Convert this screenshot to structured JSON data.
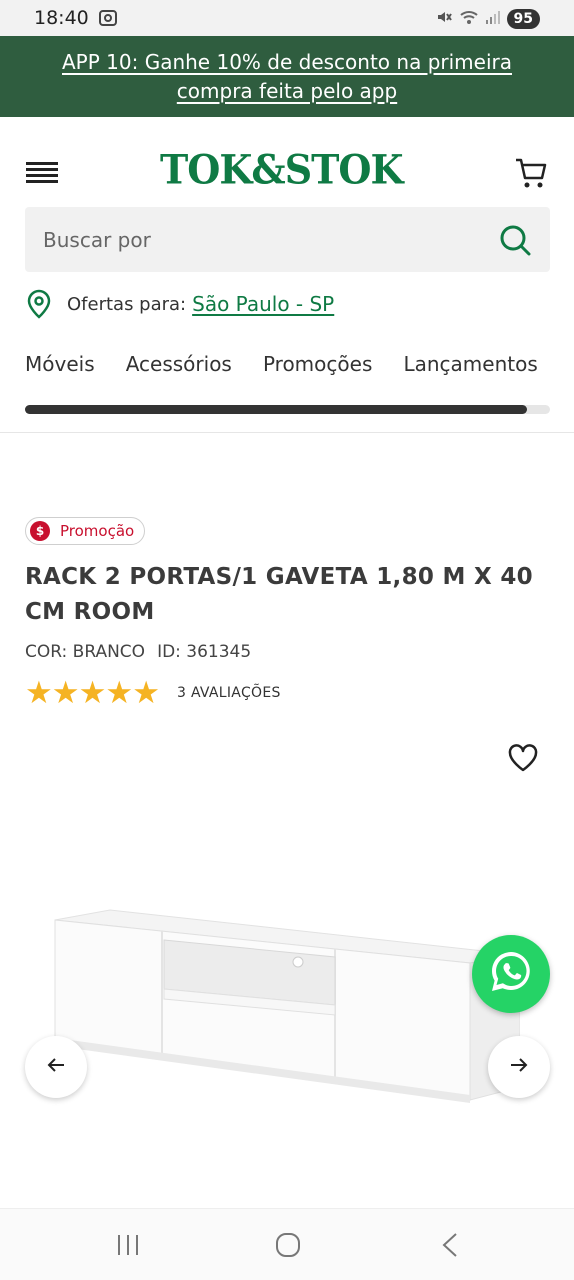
{
  "status_bar": {
    "time": "18:40",
    "battery": "95"
  },
  "promo_banner": {
    "text": "APP 10: Ganhe 10% de desconto na primeira compra feita pelo app"
  },
  "header": {
    "logo": "TOK&STOK",
    "brand_color": "#0f7a44"
  },
  "search": {
    "placeholder": "Buscar por"
  },
  "location": {
    "label": "Ofertas para:",
    "city": "São Paulo - SP"
  },
  "nav_tabs": [
    "Móveis",
    "Acessórios",
    "Promoções",
    "Lançamentos"
  ],
  "nav_scroll_progress": 0.957,
  "product": {
    "badge": "Promoção",
    "badge_symbol": "$",
    "title": "RACK 2 PORTAS/1 GAVETA 1,80 M X 40 CM ROOM",
    "color": "COR: BRANCO",
    "id": "ID: 361345",
    "rating": 5,
    "reviews": "3 AVALIAÇÕES"
  },
  "colors": {
    "banner_bg": "#2f5d3f",
    "star": "#f5b323",
    "promo_red": "#c8102e",
    "whatsapp": "#25d366"
  },
  "icons": {
    "menu": "menu-icon",
    "cart": "cart-icon",
    "search": "search-icon",
    "location": "pin-icon",
    "favorite": "heart-icon",
    "prev": "arrow-left-icon",
    "next": "arrow-right-icon",
    "chat": "whatsapp-icon"
  }
}
